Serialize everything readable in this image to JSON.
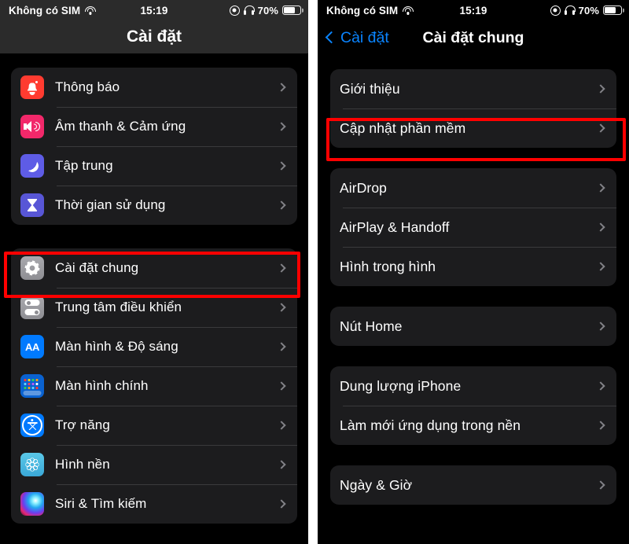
{
  "status_bar": {
    "carrier": "Không có SIM",
    "time": "15:19",
    "battery_percent": "70%",
    "wifi_icon": "wifi-icon",
    "rotation_lock_icon": "rotation-lock-icon",
    "headphones_icon": "headphones-icon",
    "battery_icon": "battery-icon"
  },
  "colors": {
    "accent_blue": "#0a84ff",
    "highlight_red": "#ff0000",
    "row_background": "#1c1c1e",
    "screen_background": "#000000",
    "separator": "#3a3a3c",
    "chevron": "#8e8e93"
  },
  "left_screen": {
    "nav_title": "Cài đặt",
    "groups": [
      {
        "rows": [
          {
            "label": "Thông báo",
            "icon": "bell-icon",
            "icon_class": "ic-bell"
          },
          {
            "label": "Âm thanh & Cảm ứng",
            "icon": "speaker-icon",
            "icon_class": "ic-speaker"
          },
          {
            "label": "Tập trung",
            "icon": "moon-icon",
            "icon_class": "ic-moon"
          },
          {
            "label": "Thời gian sử dụng",
            "icon": "hourglass-icon",
            "icon_class": "ic-hourglass"
          }
        ]
      },
      {
        "rows": [
          {
            "label": "Cài đặt chung",
            "icon": "gear-icon",
            "icon_class": "ic-gear",
            "highlighted": true
          },
          {
            "label": "Trung tâm điều khiển",
            "icon": "control-center-icon",
            "icon_class": "ic-control"
          },
          {
            "label": "Màn hình & Độ sáng",
            "icon": "display-brightness-icon",
            "icon_class": "ic-aa",
            "icon_text": "AA"
          },
          {
            "label": "Màn hình chính",
            "icon": "home-screen-icon",
            "icon_class": "ic-home"
          },
          {
            "label": "Trợ năng",
            "icon": "accessibility-icon",
            "icon_class": "ic-access"
          },
          {
            "label": "Hình nền",
            "icon": "wallpaper-icon",
            "icon_class": "ic-wall"
          },
          {
            "label": "Siri & Tìm kiếm",
            "icon": "siri-icon",
            "icon_class": "ic-siri"
          }
        ]
      }
    ]
  },
  "right_screen": {
    "back_label": "Cài đặt",
    "back_icon": "chevron-left-icon",
    "nav_title": "Cài đặt chung",
    "groups": [
      {
        "rows": [
          {
            "label": "Giới thiệu"
          },
          {
            "label": "Cập nhật phần mềm",
            "highlighted": true
          }
        ]
      },
      {
        "rows": [
          {
            "label": "AirDrop"
          },
          {
            "label": "AirPlay & Handoff"
          },
          {
            "label": "Hình trong hình"
          }
        ]
      },
      {
        "rows": [
          {
            "label": "Nút Home"
          }
        ]
      },
      {
        "rows": [
          {
            "label": "Dung lượng iPhone"
          },
          {
            "label": "Làm mới ứng dụng trong nền"
          }
        ]
      },
      {
        "rows": [
          {
            "label": "Ngày & Giờ"
          }
        ]
      }
    ]
  }
}
